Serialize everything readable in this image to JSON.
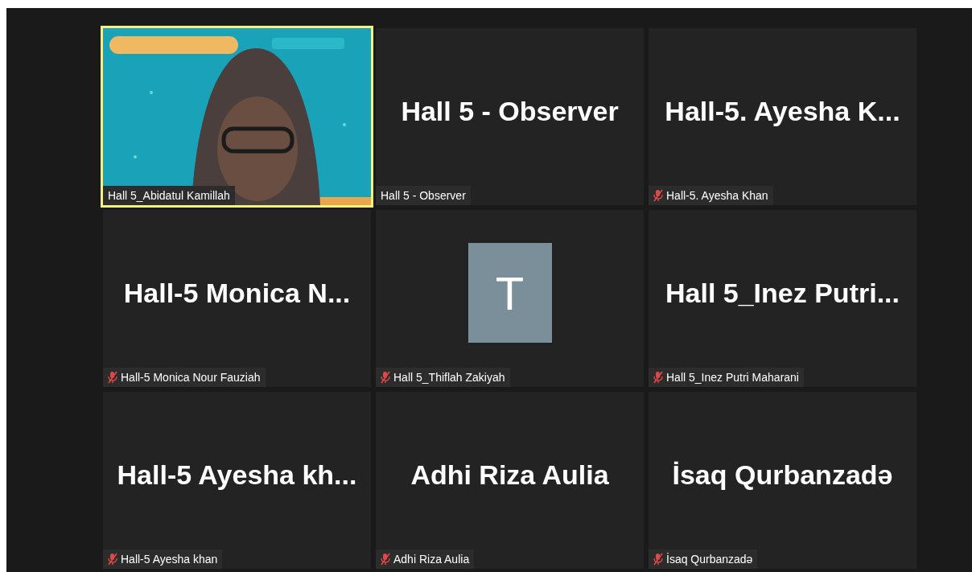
{
  "tiles": [
    {
      "kind": "video",
      "label": "Hall 5_Abidatul Kamillah",
      "muted": false,
      "speaking": true
    },
    {
      "kind": "name",
      "display_name": "Hall 5 - Observer",
      "label": "Hall 5 - Observer",
      "muted": false,
      "speaking": false
    },
    {
      "kind": "name",
      "display_name": "Hall-5. Ayesha K...",
      "label": "Hall-5. Ayesha Khan",
      "muted": true,
      "speaking": false
    },
    {
      "kind": "name",
      "display_name": "Hall-5 Monica N...",
      "label": "Hall-5 Monica Nour Fauziah",
      "muted": true,
      "speaking": false
    },
    {
      "kind": "avatar",
      "initial": "T",
      "label": "Hall 5_Thiflah Zakiyah",
      "muted": true,
      "speaking": false
    },
    {
      "kind": "name",
      "display_name": "Hall 5_Inez Putri...",
      "label": "Hall 5_Inez Putri Maharani",
      "muted": true,
      "speaking": false
    },
    {
      "kind": "name",
      "display_name": "Hall-5 Ayesha kh...",
      "label": "Hall-5 Ayesha khan",
      "muted": true,
      "speaking": false
    },
    {
      "kind": "name",
      "display_name": "Adhi Riza Aulia",
      "label": "Adhi Riza Aulia",
      "muted": true,
      "speaking": false
    },
    {
      "kind": "name",
      "display_name": "İsaq Qurbanzadə",
      "label": "İsaq Qurbanzadə",
      "muted": true,
      "speaking": false
    }
  ]
}
